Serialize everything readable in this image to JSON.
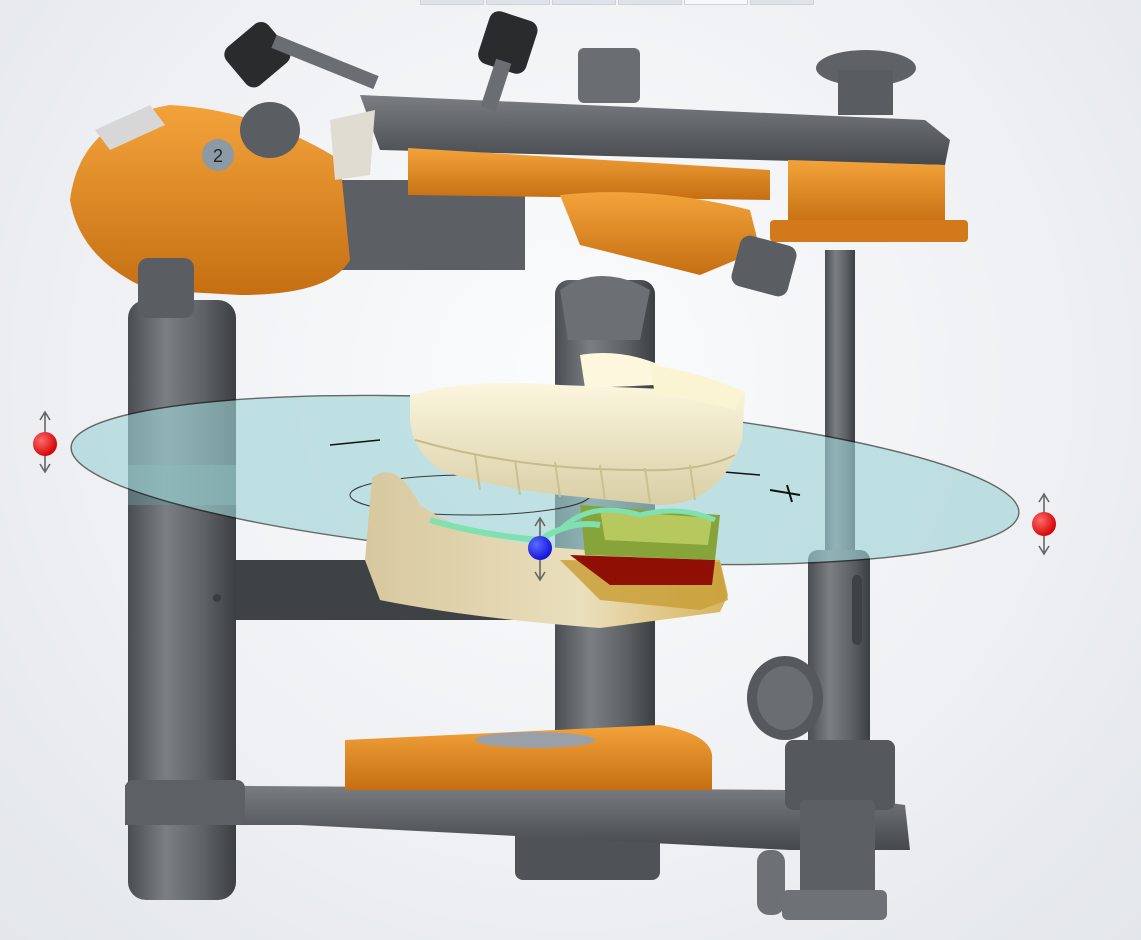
{
  "window": {
    "title": ""
  },
  "toolbar": {
    "tabs": [
      "",
      "",
      "",
      "",
      "",
      ""
    ],
    "active_tab_index": 4
  },
  "scene": {
    "objects": [
      "articulator-frame",
      "upper-arch",
      "lower-arch",
      "occlusal-plane"
    ],
    "colors": {
      "frame": "#6a6d71",
      "accent": "#e08a22",
      "plane": "#9fd3d6",
      "teeth": "#f6efcc",
      "gingiva": "#e9d9b0",
      "handle_active": "#1717e6",
      "handle_move": "#e31010"
    },
    "labels": {
      "upper_knob_number": "2"
    },
    "handles": [
      "plane-handle-left",
      "plane-handle-right",
      "plane-handle-center"
    ]
  }
}
